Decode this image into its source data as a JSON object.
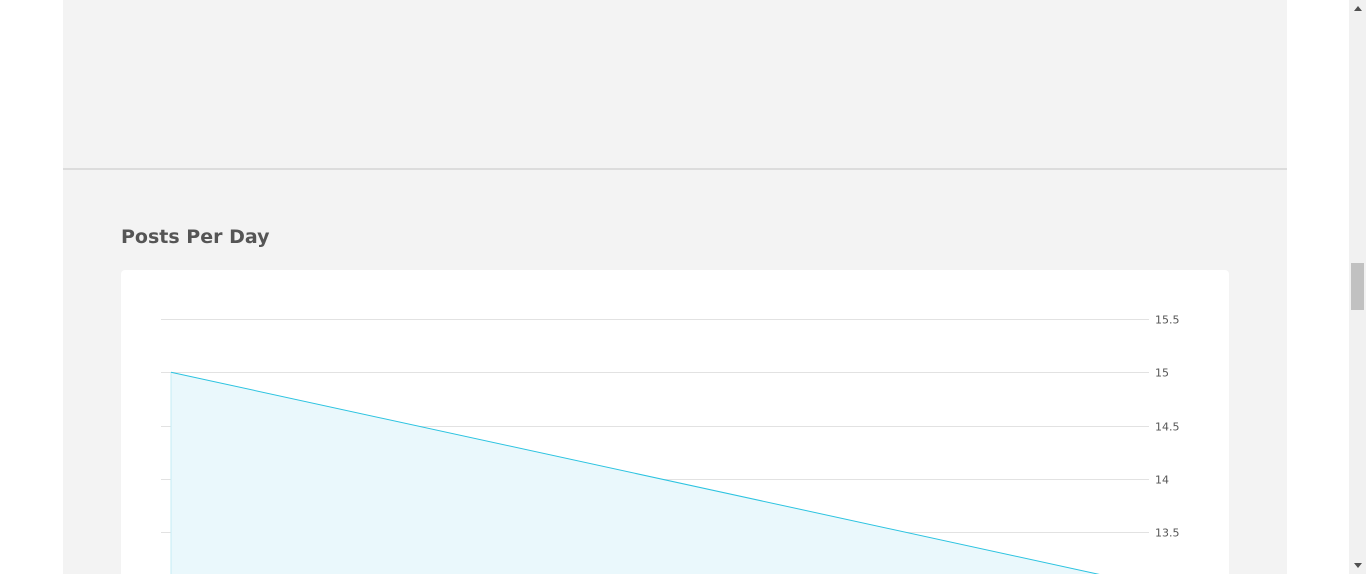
{
  "section": {
    "title": "Posts Per Day"
  },
  "colors": {
    "line": "#2cc3e0",
    "area": "#eaf8fc",
    "grid": "#e2e2e2",
    "panel_background": "#f3f3f3",
    "card_background": "#ffffff"
  },
  "scrollbar": {
    "up_icon": "triangle-up-icon",
    "down_icon": "triangle-down-icon"
  },
  "chart_data": {
    "type": "area",
    "title": "Posts Per Day",
    "xlabel": "",
    "ylabel": "",
    "y_axis_position": "right",
    "grid": true,
    "ylim": [
      13,
      15.5
    ],
    "yticks": [
      {
        "value": 15.5,
        "label": "15.5"
      },
      {
        "value": 15,
        "label": "15"
      },
      {
        "value": 14.5,
        "label": "14.5"
      },
      {
        "value": 14,
        "label": "14"
      },
      {
        "value": 13.5,
        "label": "13.5"
      }
    ],
    "x": [
      0,
      1
    ],
    "series": [
      {
        "values": [
          15,
          13
        ]
      }
    ]
  }
}
